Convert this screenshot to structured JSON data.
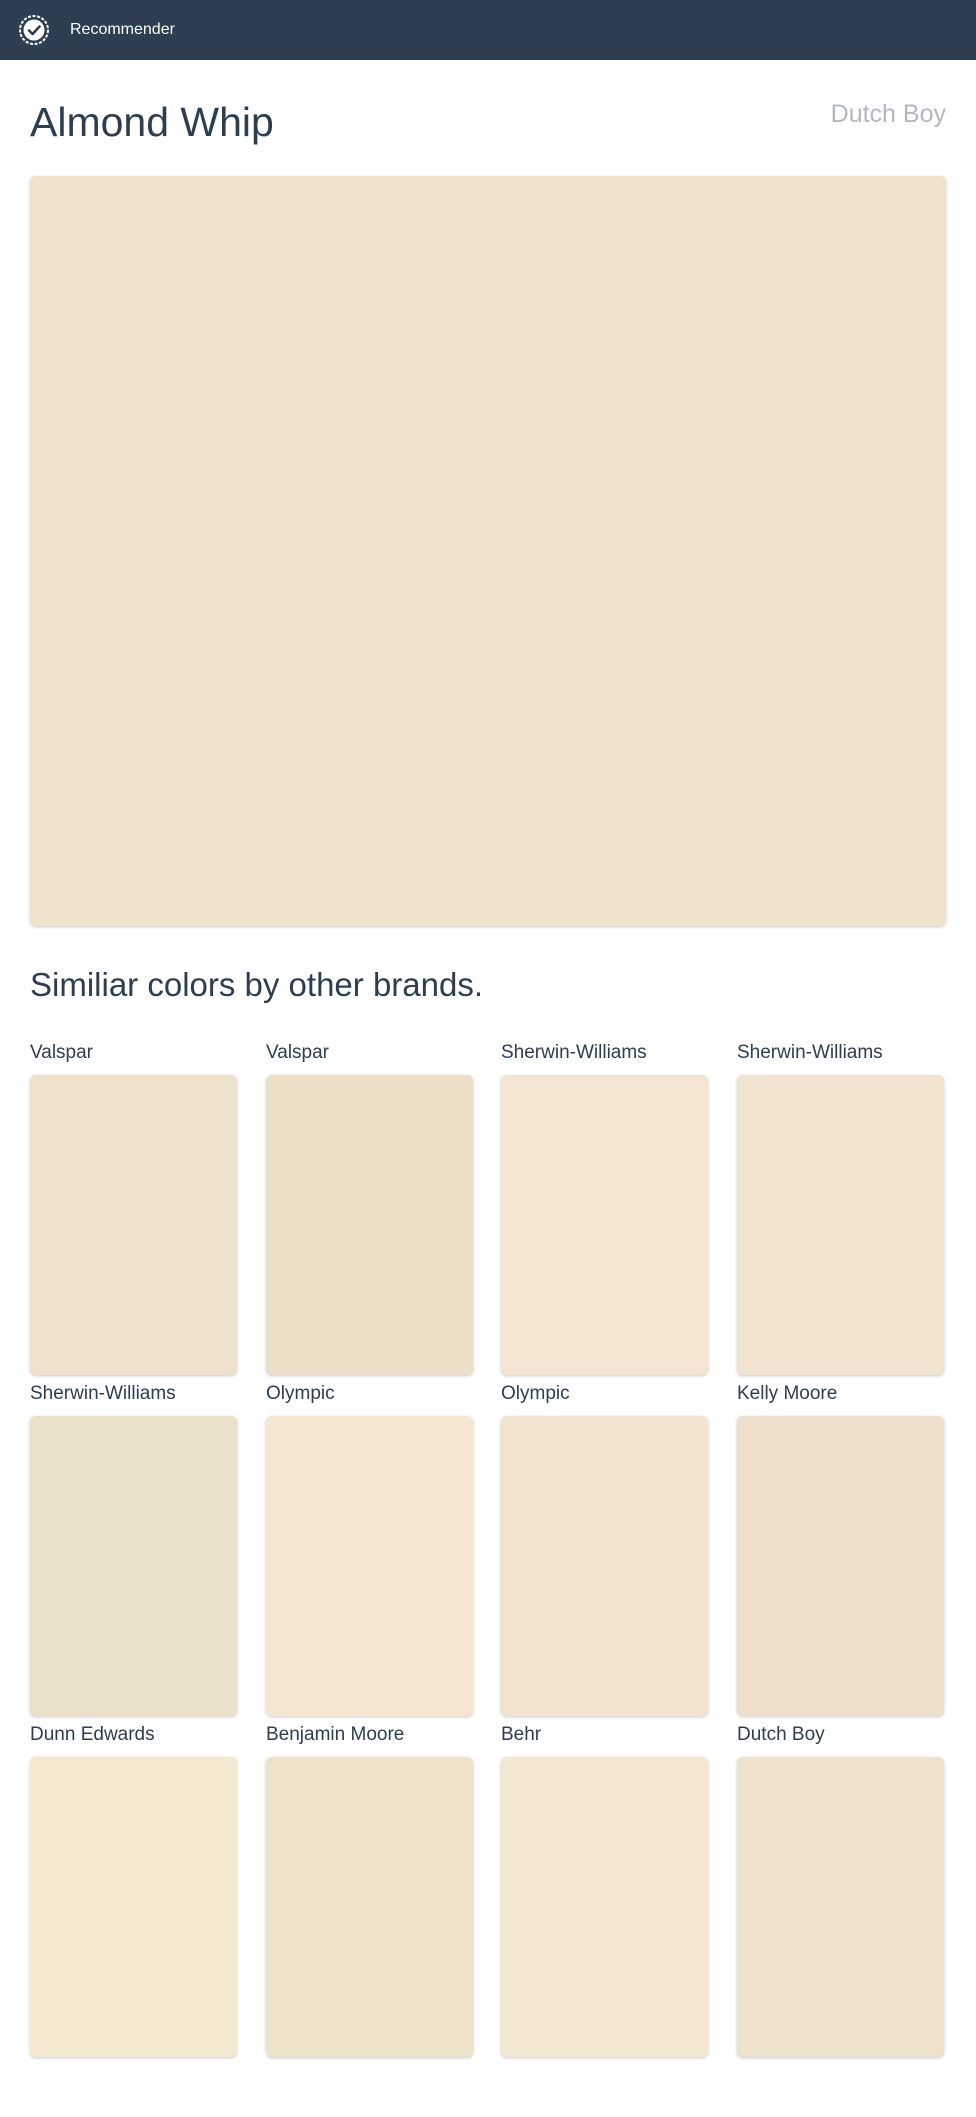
{
  "navbar": {
    "logo_icon": "check-badge-icon",
    "brand_label": "Recommender"
  },
  "color": {
    "name": "Almond Whip",
    "brand": "Dutch Boy",
    "swatch_hex": "#efe2cd"
  },
  "similar": {
    "heading": "Similiar colors by other brands.",
    "items": [
      {
        "brand": "Valspar",
        "hex": "#eee2cd"
      },
      {
        "brand": "Valspar",
        "hex": "#ebdfc8"
      },
      {
        "brand": "Sherwin-Williams",
        "hex": "#f3e5d1"
      },
      {
        "brand": "Sherwin-Williams",
        "hex": "#f0e3cf"
      },
      {
        "brand": "Sherwin-Williams",
        "hex": "#ebe0ca"
      },
      {
        "brand": "Olympic",
        "hex": "#f4e6d0"
      },
      {
        "brand": "Olympic",
        "hex": "#f3e4d1"
      },
      {
        "brand": "Kelly Moore",
        "hex": "#eee0cc"
      },
      {
        "brand": "Dunn Edwards",
        "hex": "#f4e8d1"
      },
      {
        "brand": "Benjamin Moore",
        "hex": "#eee2cb"
      },
      {
        "brand": "Behr",
        "hex": "#f4e7d1"
      },
      {
        "brand": "Dutch Boy",
        "hex": "#efe2cd"
      }
    ]
  }
}
